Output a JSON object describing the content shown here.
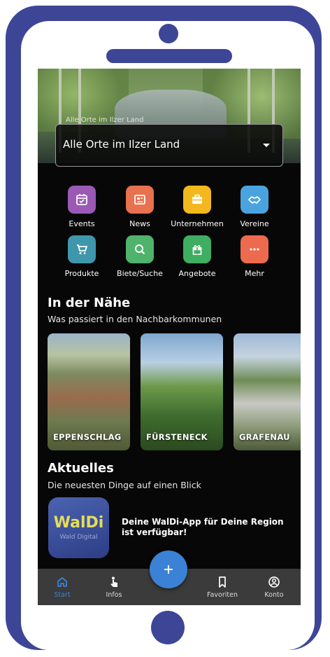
{
  "location": {
    "legend": "Alle Orte im Ilzer Land",
    "value": "Alle Orte im Ilzer Land"
  },
  "categories": [
    {
      "label": "Events",
      "icon": "calendar-icon",
      "color": "#9b59b6"
    },
    {
      "label": "News",
      "icon": "newspaper-icon",
      "color": "#e8714f"
    },
    {
      "label": "Unternehmen",
      "icon": "briefcase-icon",
      "color": "#f2b81e"
    },
    {
      "label": "Vereine",
      "icon": "handshake-icon",
      "color": "#4aa3df"
    },
    {
      "label": "Produkte",
      "icon": "cart-icon",
      "color": "#3f97ab"
    },
    {
      "label": "Biete/Suche",
      "icon": "search-icon",
      "color": "#4fb36c"
    },
    {
      "label": "Angebote",
      "icon": "gift-icon",
      "color": "#3fae62"
    },
    {
      "label": "Mehr",
      "icon": "more-icon",
      "color": "#ee6a4f"
    }
  ],
  "nearby": {
    "title": "In der Nähe",
    "subtitle": "Was passiert in den Nachbarkommunen",
    "places": [
      {
        "name": "EPPENSCHLAG"
      },
      {
        "name": "FÜRSTENECK"
      },
      {
        "name": "GRAFENAU"
      }
    ]
  },
  "news": {
    "title": "Aktuelles",
    "subtitle": "Die neuesten Dinge auf einen Blick",
    "logo_title": "WalDi",
    "logo_subtitle": "Wald Digital",
    "item_text": "Deine WalDi-App für Deine Region ist verfügbar!"
  },
  "nav": {
    "start": "Start",
    "infos": "Infos",
    "favoriten": "Favoriten",
    "konto": "Konto",
    "active_color": "#3b82d6"
  }
}
